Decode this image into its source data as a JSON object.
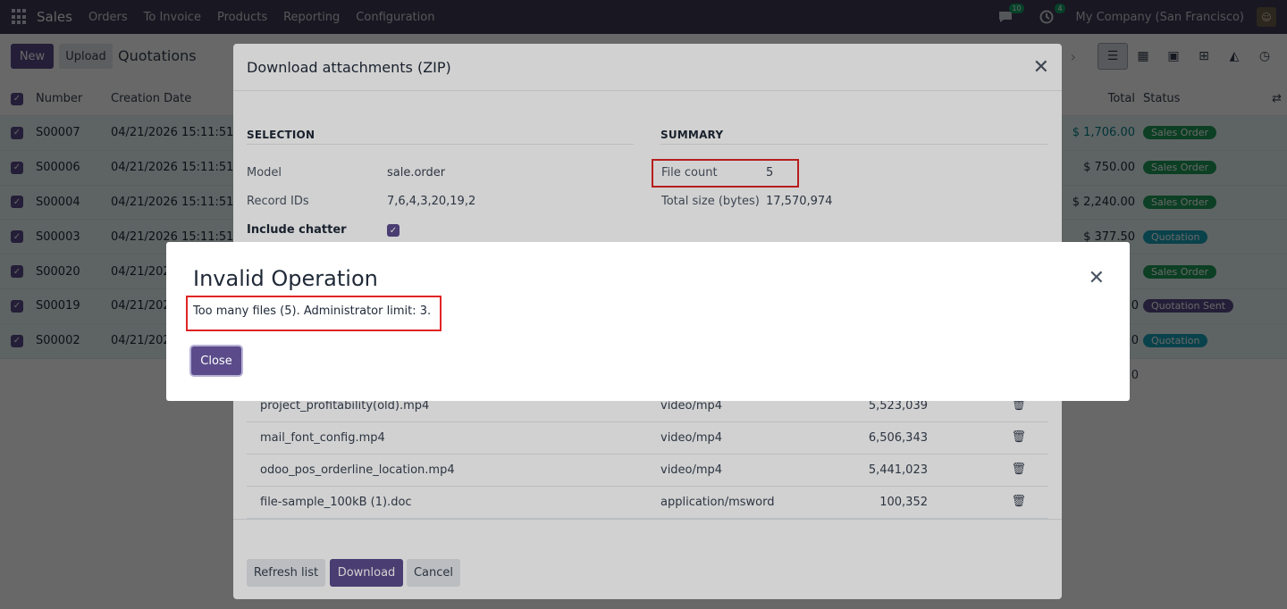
{
  "navbar": {
    "brand": "Sales",
    "menu": [
      "Orders",
      "To Invoice",
      "Products",
      "Reporting",
      "Configuration"
    ],
    "messages_count": "10",
    "activities_count": "4",
    "company": "My Company (San Francisco)"
  },
  "control": {
    "new_label": "New",
    "upload_label": "Upload",
    "breadcrumb": "Quotations"
  },
  "list": {
    "headers": {
      "number": "Number",
      "creation_date": "Creation Date",
      "total": "Total",
      "status": "Status"
    },
    "rows": [
      {
        "number": "S00007",
        "date": "04/21/2026 15:11:51",
        "total": "$ 1,706.00",
        "status": "Sales Order"
      },
      {
        "number": "S00006",
        "date": "04/21/2026 15:11:51",
        "total": "$ 750.00",
        "status": "Sales Order"
      },
      {
        "number": "S00004",
        "date": "04/21/2026 15:11:51",
        "total": "$ 2,240.00",
        "status": "Sales Order"
      },
      {
        "number": "S00003",
        "date": "04/21/2026 15:11:51",
        "total": "$ 377.50",
        "status": "Quotation"
      },
      {
        "number": "S00020",
        "date": "04/21/202",
        "total": "",
        "status": "Sales Order"
      },
      {
        "number": "S00019",
        "date": "04/21/202",
        "total": "0",
        "status": "Quotation Sent"
      },
      {
        "number": "S00002",
        "date": "04/21/202",
        "total": "0",
        "status": "Quotation"
      }
    ],
    "footer_total": "0"
  },
  "zip_dialog": {
    "title": "Download attachments (ZIP)",
    "selection_title": "SELECTION",
    "summary_title": "SUMMARY",
    "model_label": "Model",
    "model_value": "sale.order",
    "record_ids_label": "Record IDs",
    "record_ids_value": "7,6,4,3,20,19,2",
    "include_chatter_label": "Include chatter",
    "file_count_label": "File count",
    "file_count_value": "5",
    "total_size_label": "Total size (bytes)",
    "total_size_value": "17,570,974",
    "files": [
      {
        "name": "project_profitability(old).mp4",
        "type": "video/mp4",
        "size": "5,523,039"
      },
      {
        "name": "mail_font_config.mp4",
        "type": "video/mp4",
        "size": "6,506,343"
      },
      {
        "name": "odoo_pos_orderline_location.mp4",
        "type": "video/mp4",
        "size": "5,441,023"
      },
      {
        "name": "file-sample_100kB (1).doc",
        "type": "application/msword",
        "size": "100,352"
      }
    ],
    "refresh_label": "Refresh list",
    "download_label": "Download",
    "cancel_label": "Cancel"
  },
  "error_dialog": {
    "title": "Invalid Operation",
    "message": "Too many files (5). Administrator limit: 3.",
    "close_label": "Close"
  }
}
